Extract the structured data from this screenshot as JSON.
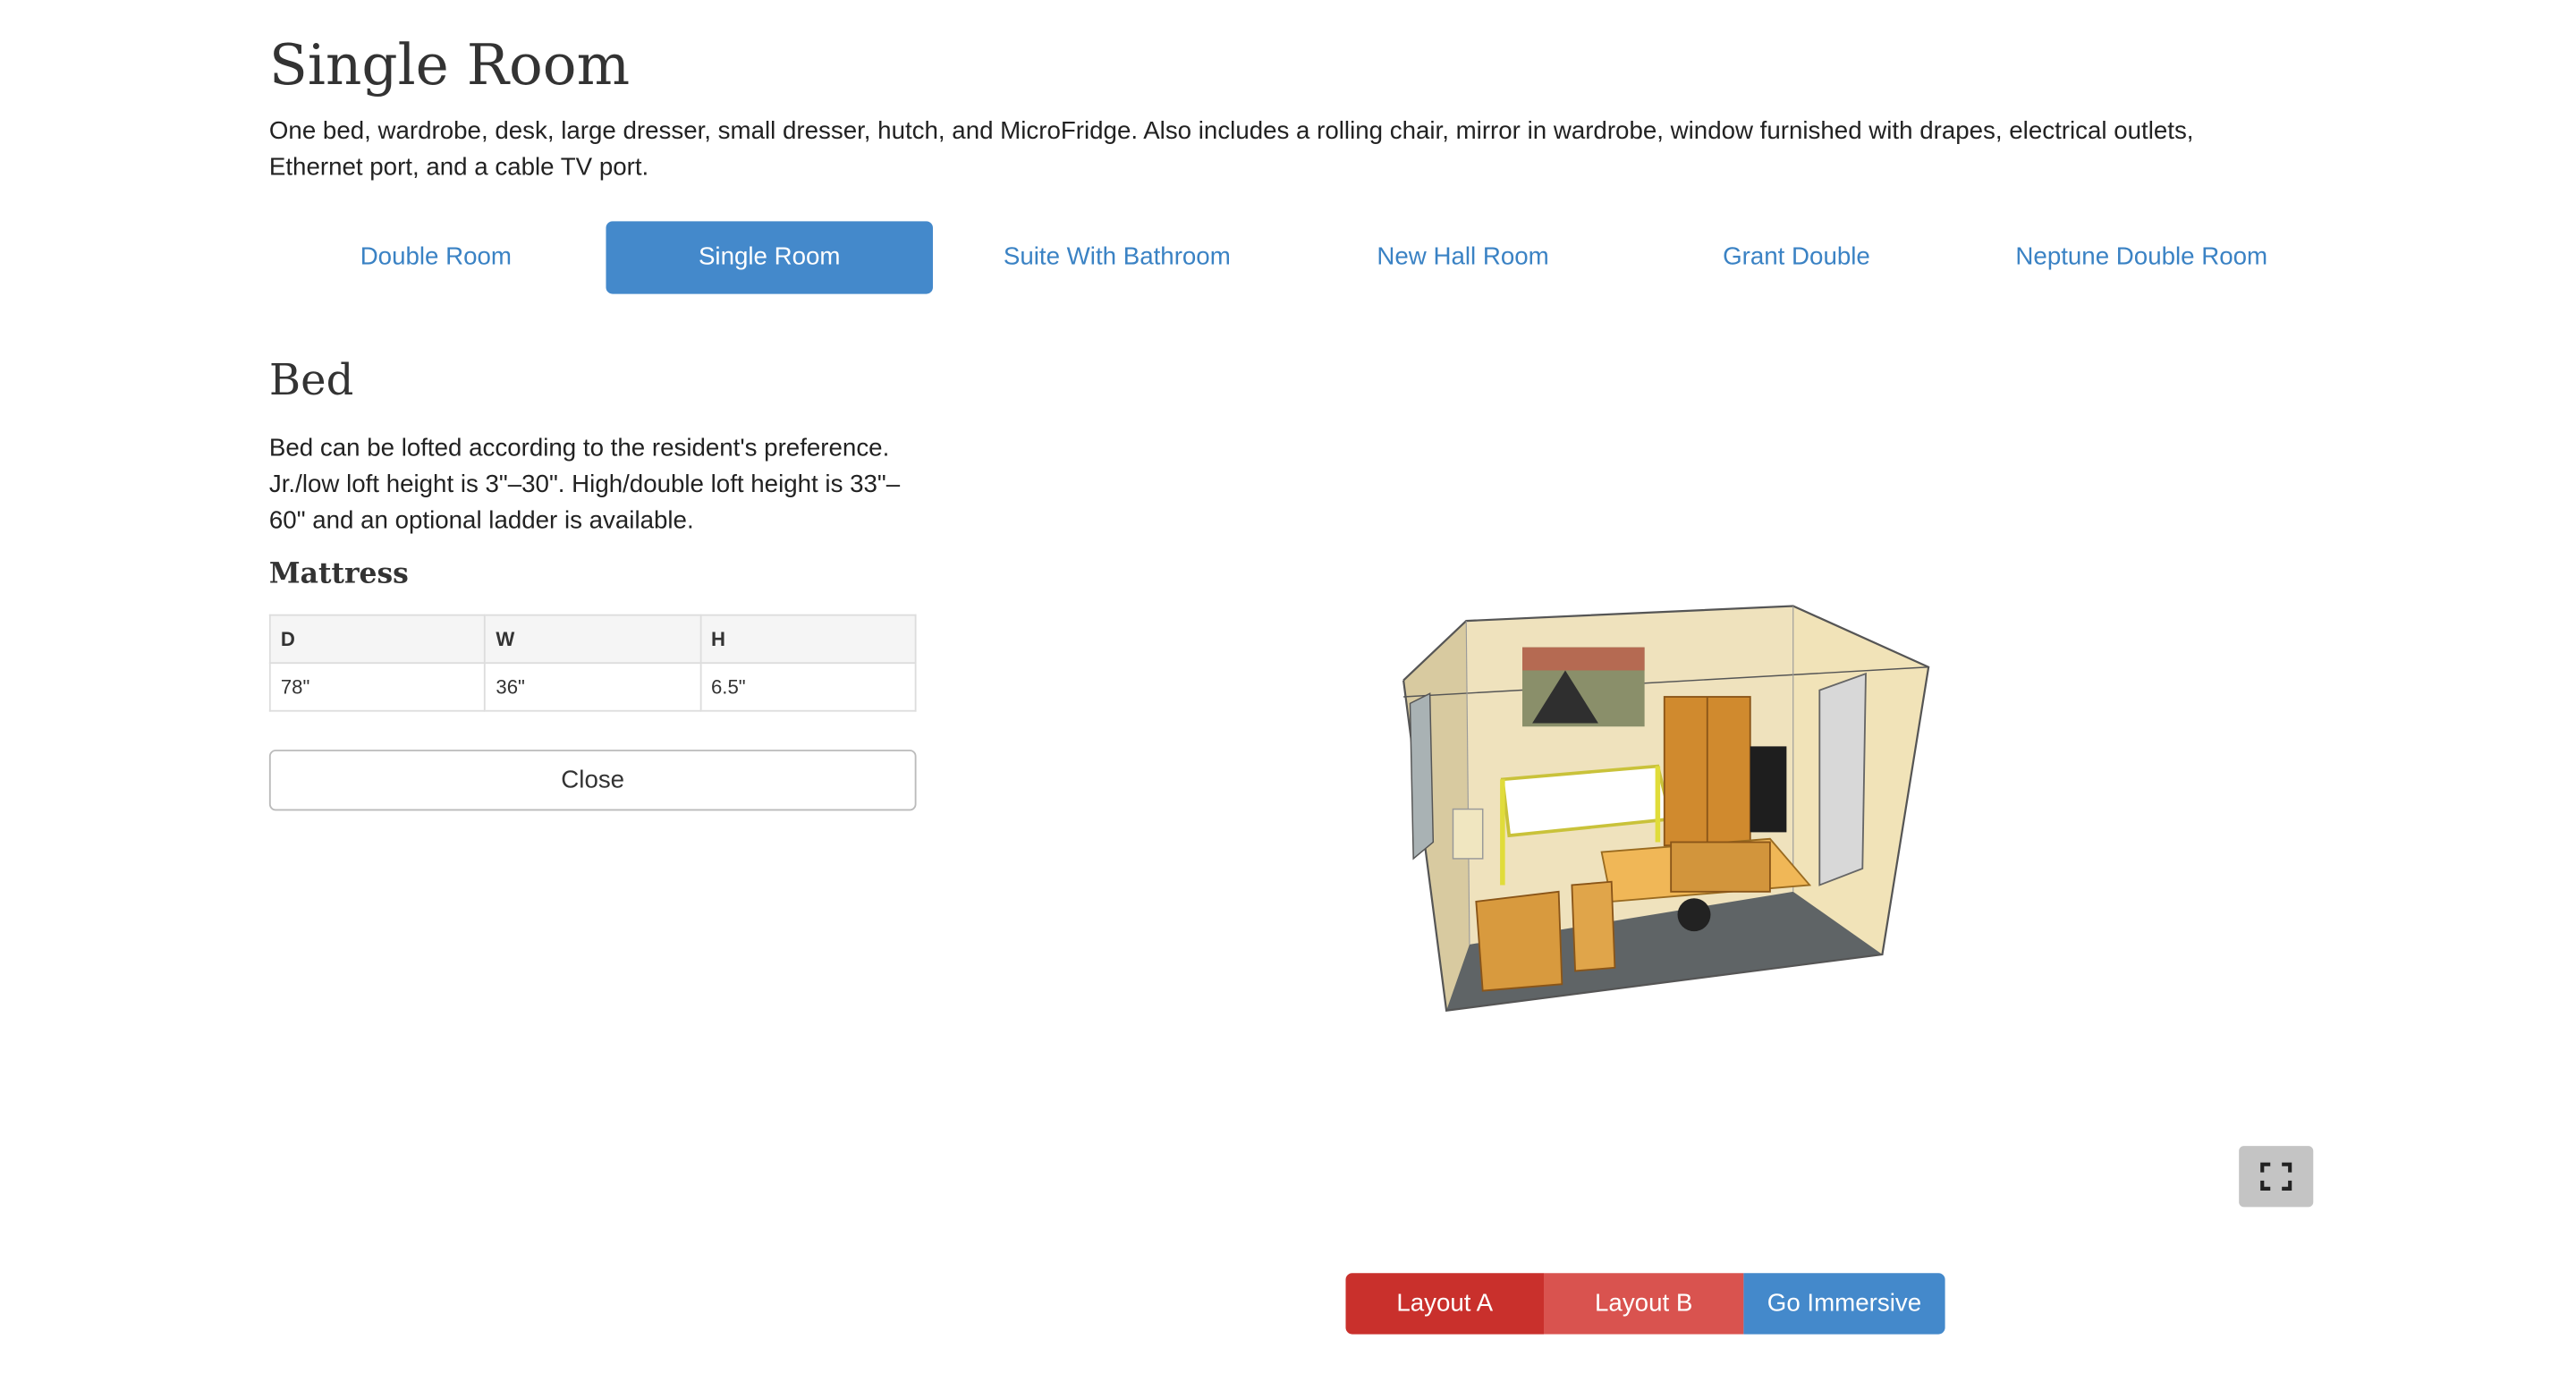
{
  "header": {
    "title": "Single Room",
    "description": "One bed, wardrobe, desk, large dresser, small dresser, hutch, and MicroFridge. Also includes a rolling chair, mirror in wardrobe, window furnished with drapes, electrical outlets, Ethernet port, and a cable TV port."
  },
  "tabs": [
    {
      "label": "Double Room",
      "active": false
    },
    {
      "label": "Single Room",
      "active": true
    },
    {
      "label": "Suite With Bathroom",
      "active": false
    },
    {
      "label": "New Hall Room",
      "active": false
    },
    {
      "label": "Grant Double",
      "active": false
    },
    {
      "label": "Neptune Double Room",
      "active": false
    }
  ],
  "detail": {
    "title": "Bed",
    "description": "Bed can be lofted according to the resident's preference. Jr./low loft height is 3\"–30\". High/double loft height is 33\"–60\" and an optional ladder is available.",
    "subtitle": "Mattress",
    "table": {
      "headers": [
        "D",
        "W",
        "H"
      ],
      "values": [
        "78\"",
        "36\"",
        "6.5\""
      ]
    },
    "close_label": "Close"
  },
  "viewer": {
    "fullscreen_icon": "expand-icon",
    "layout_buttons": {
      "a": "Layout A",
      "b": "Layout B",
      "immersive": "Go Immersive"
    }
  },
  "colors": {
    "tab_active": "#4489cb",
    "link": "#3a82c4",
    "layout_a": "#c9302c",
    "layout_b": "#d9534f",
    "immersive": "#4489cb"
  }
}
